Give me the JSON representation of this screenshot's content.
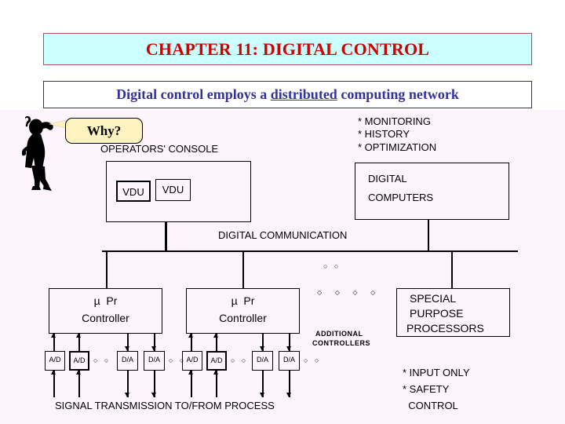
{
  "slide": {
    "title": "CHAPTER 11: DIGITAL CONTROL",
    "title_bg": "#CCFFFF",
    "title_color": "#CC0000",
    "subtitle_pre": "Digital control employs a ",
    "subtitle_emph": "distributed",
    "subtitle_post": " computing network",
    "subtitle_color": "#333399"
  },
  "diagram": {
    "why_balloon": "Why?",
    "operators_console_label": "OPERATORS' CONSOLE",
    "vdu_1": "VDU",
    "vdu_2": "VDU",
    "computer_notes": "* MONITORING\n* HISTORY\n* OPTIMIZATION",
    "digital_computers_line1": "DIGITAL",
    "digital_computers_line2": "COMPUTERS",
    "bus_label": "DIGITAL COMMUNICATION",
    "bus_dots": "○ ○",
    "controller_1_line1": "µ  Pr",
    "controller_1_line2": "Controller",
    "controller_2_line1": "µ  Pr",
    "controller_2_line2": "Controller",
    "additional_diamonds": "◇ ◇ ◇ ◇",
    "additional_controllers_line1": "ADDITIONAL",
    "additional_controllers_line2": "CONTROLLERS",
    "special_purpose_line1": "SPECIAL",
    "special_purpose_line2": "PURPOSE",
    "special_purpose_line3": "PROCESSORS",
    "special_notes_line1": "* INPUT ONLY",
    "special_notes_line2": "* SAFETY",
    "special_notes_line3": "  CONTROL",
    "signal_label": "SIGNAL TRANSMISSION TO/FROM PROCESS",
    "converters": {
      "c1_ad_1": "A/D",
      "c1_ad_2": "A/D",
      "c1_ad_dots": "○ ○",
      "c1_da_1": "D/A",
      "c1_da_2": "D/A",
      "c1_da_dots": "○ ○",
      "c2_ad_1": "A/D",
      "c2_ad_2": "A/D",
      "c2_ad_dots": "○ ○",
      "c2_da_1": "D/A",
      "c2_da_2": "D/A",
      "c2_da_dots": "○ ○"
    }
  }
}
